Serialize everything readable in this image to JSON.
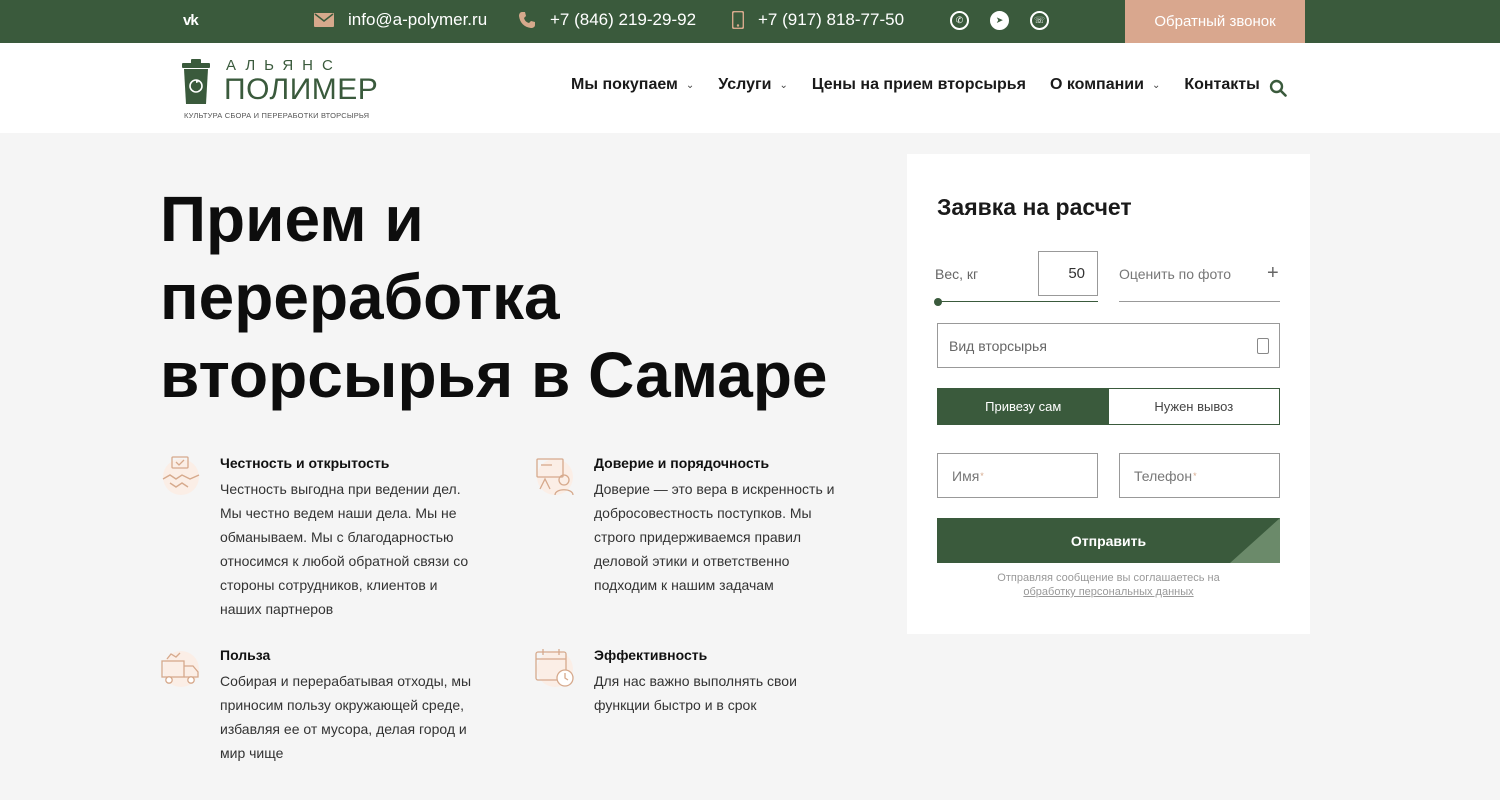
{
  "topbar": {
    "vk_label": "vk",
    "email": "info@a-polymer.ru",
    "phone_1": "+7 (846) 219-29-92",
    "phone_2": "+7 (917) 818-77-50",
    "callback_label": "Обратный звонок"
  },
  "logo": {
    "top_word": "АЛЬЯНС",
    "main_word": "ПОЛИМЕР",
    "tagline": "КУЛЬТУРА СБОРА И ПЕРЕРАБОТКИ ВТОРСЫРЬЯ"
  },
  "nav": {
    "items": [
      {
        "label": "Мы покупаем",
        "dropdown": true
      },
      {
        "label": "Услуги",
        "dropdown": true
      },
      {
        "label": "Цены на прием вторсырья",
        "dropdown": false
      },
      {
        "label": "О компании",
        "dropdown": true
      },
      {
        "label": "Контакты",
        "dropdown": false
      }
    ]
  },
  "hero": {
    "title_line_1": "Прием и",
    "title_line_2": "переработка",
    "title_line_3": "вторсырья в Самаре"
  },
  "features": [
    {
      "title": "Честность и открытость",
      "text": "Честность выгодна при ведении дел. Мы честно ведем наши дела. Мы не обманываем. Мы с благодарностью относимся к любой обратной связи со стороны сотрудников, клиентов и наших партнеров",
      "icon": "handshake-icon"
    },
    {
      "title": "Доверие и порядочность",
      "text": "Доверие — это вера в искренность и добросовестность поступков. Мы строго придерживаемся правил деловой этики и ответственно подходим к нашим задачам",
      "icon": "trust-icon"
    },
    {
      "title": "Польза",
      "text": "Собирая и перерабатывая отходы, мы приносим пользу окружающей среде, избавляя ее от мусора, делая город и мир чище",
      "icon": "truck-icon"
    },
    {
      "title": "Эффективность",
      "text": "Для нас важно выполнять свои функции быстро и в срок",
      "icon": "calendar-clock-icon"
    }
  ],
  "form": {
    "title": "Заявка на расчет",
    "weight_label": "Вес, кг",
    "weight_value": "50",
    "photo_label": "Оценить по фото",
    "material_placeholder": "Вид вторсырья",
    "toggle_self": "Привезу сам",
    "toggle_pickup": "Нужен вывоз",
    "name_placeholder": "Имя",
    "phone_placeholder": "Телефон",
    "required_mark": "*",
    "submit_label": "Отправить",
    "consent_text": "Отправляя сообщение вы соглашаетесь на",
    "consent_link": "обработку персональных данных"
  },
  "colors": {
    "brand_green": "#3a5a3c",
    "accent_peach": "#d9a78e"
  }
}
